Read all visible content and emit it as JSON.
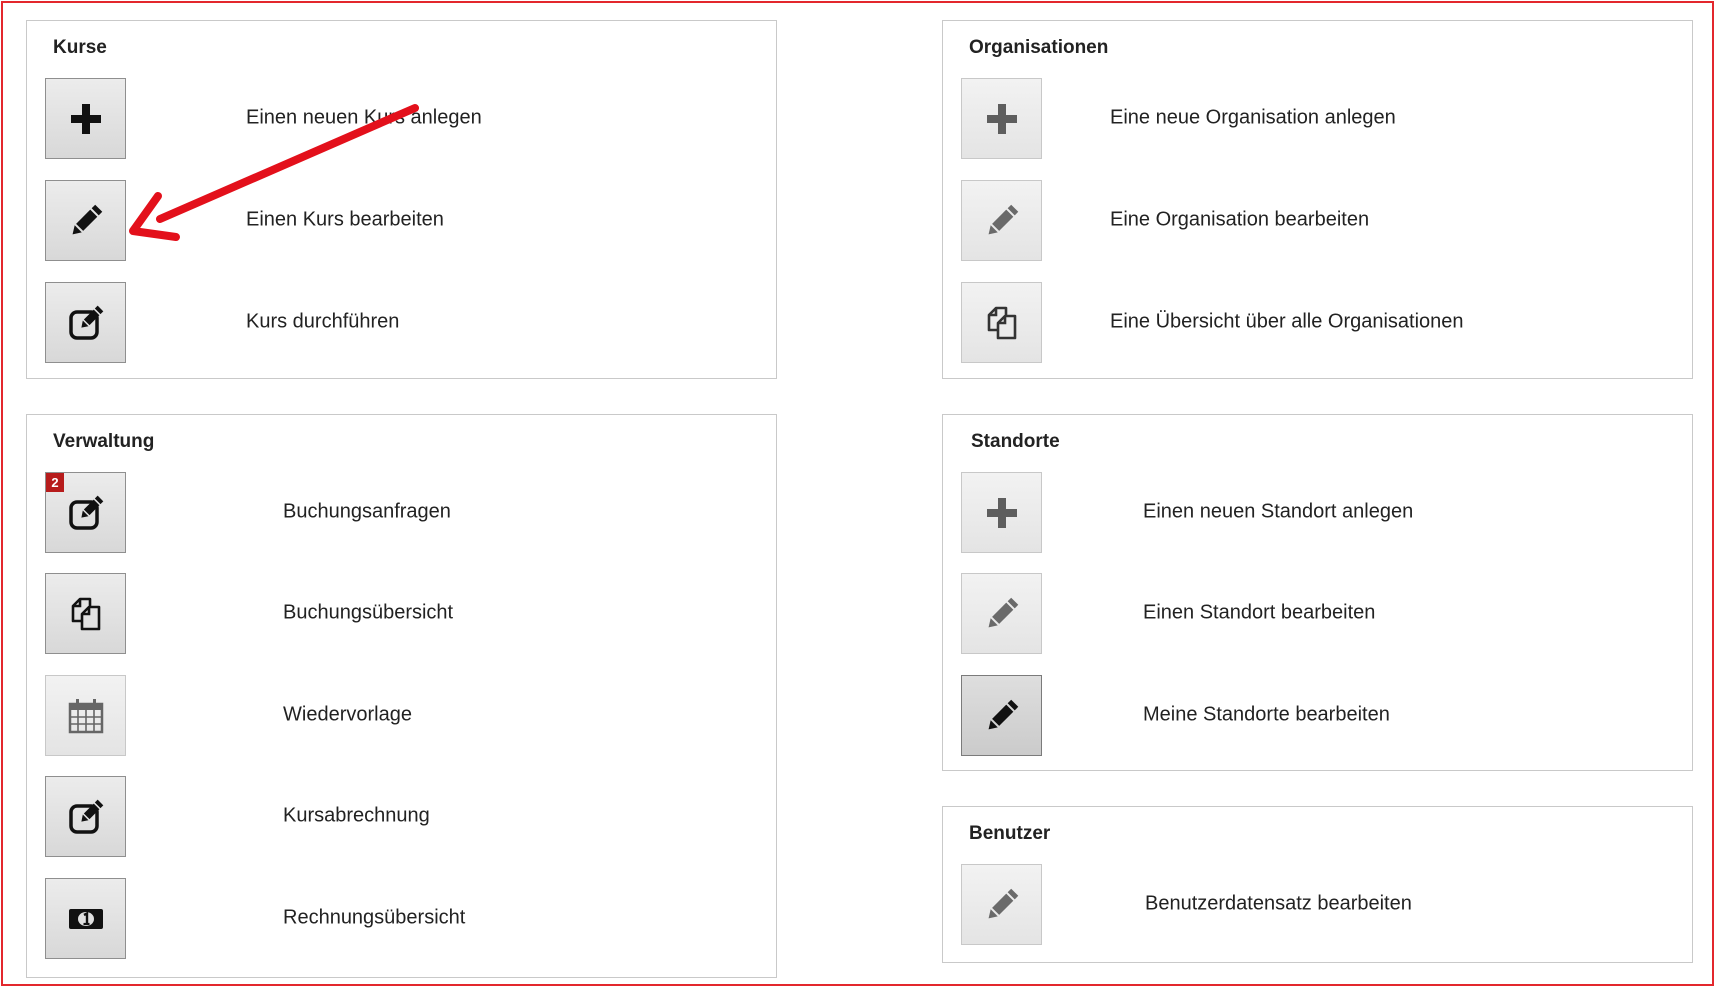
{
  "colors": {
    "frame": "#e3272d",
    "arrow": "#e3101b",
    "badge": "#b71c1c"
  },
  "kurse": {
    "title": "Kurse",
    "items": [
      {
        "label": "Einen neuen Kurs anlegen",
        "icon": "plus-icon"
      },
      {
        "label": "Einen Kurs bearbeiten",
        "icon": "pencil-icon"
      },
      {
        "label": "Kurs durchführen",
        "icon": "edit-square-icon"
      }
    ]
  },
  "organisationen": {
    "title": "Organisationen",
    "items": [
      {
        "label": "Eine neue Organisation anlegen",
        "icon": "plus-icon"
      },
      {
        "label": "Eine Organisation bearbeiten",
        "icon": "pencil-icon"
      },
      {
        "label": "Eine Übersicht über alle Organisationen",
        "icon": "copy-icon"
      }
    ]
  },
  "verwaltung": {
    "title": "Verwaltung",
    "items": [
      {
        "label": "Buchungsanfragen",
        "icon": "edit-square-icon",
        "badge": "2"
      },
      {
        "label": "Buchungsübersicht",
        "icon": "copy-icon"
      },
      {
        "label": "Wiedervorlage",
        "icon": "calendar-icon"
      },
      {
        "label": "Kursabrechnung",
        "icon": "edit-square-icon"
      },
      {
        "label": "Rechnungsübersicht",
        "icon": "money-icon"
      }
    ]
  },
  "standorte": {
    "title": "Standorte",
    "items": [
      {
        "label": "Einen neuen Standort anlegen",
        "icon": "plus-icon"
      },
      {
        "label": "Einen Standort bearbeiten",
        "icon": "pencil-icon"
      },
      {
        "label": "Meine Standorte bearbeiten",
        "icon": "pencil-icon"
      }
    ]
  },
  "benutzer": {
    "title": "Benutzer",
    "items": [
      {
        "label": "Benutzerdatensatz bearbeiten",
        "icon": "pencil-icon"
      }
    ]
  }
}
